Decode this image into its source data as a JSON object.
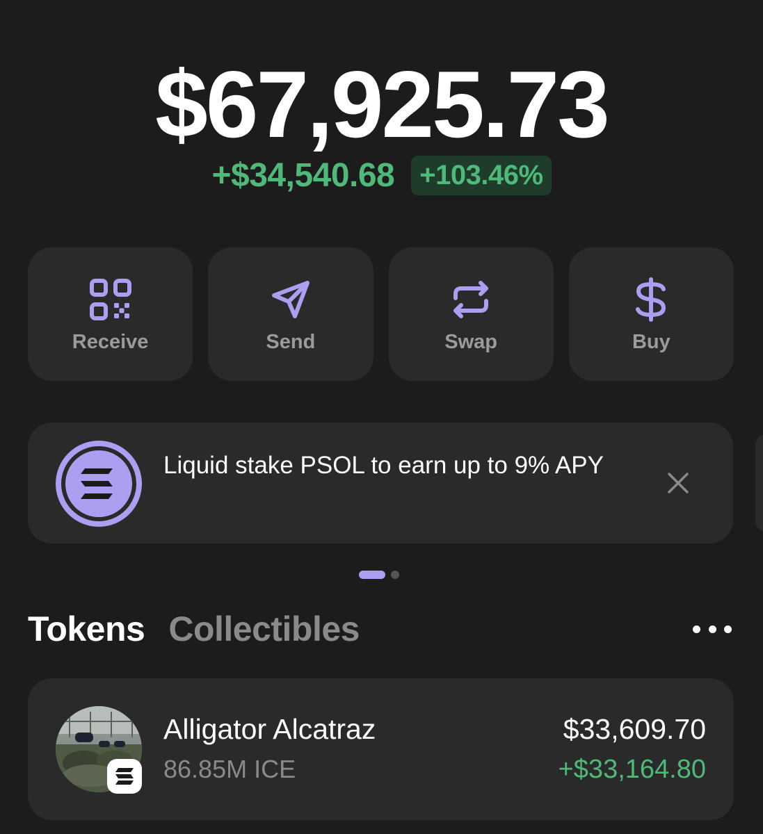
{
  "portfolio": {
    "balance": "$67,925.73",
    "change_amount": "+$34,540.68",
    "change_percent": "+103.46%"
  },
  "actions": [
    {
      "label": "Receive",
      "icon": "qr-code-icon"
    },
    {
      "label": "Send",
      "icon": "send-icon"
    },
    {
      "label": "Swap",
      "icon": "swap-icon"
    },
    {
      "label": "Buy",
      "icon": "dollar-icon"
    }
  ],
  "promo": {
    "text": "Liquid stake PSOL to earn up to 9% APY",
    "logo": "solana-logo-icon",
    "close_icon": "close-icon",
    "page_index": 1,
    "page_count": 2
  },
  "tabs": {
    "active": "Tokens",
    "items": [
      "Tokens",
      "Collectibles"
    ],
    "more_icon": "more-horizontal-icon"
  },
  "tokens": [
    {
      "name": "Alligator Alcatraz",
      "amount": "86.85M ICE",
      "value": "$33,609.70",
      "change": "+$33,164.80",
      "chain": "solana"
    }
  ],
  "colors": {
    "background": "#1c1c1c",
    "card": "#2a2a2a",
    "accent": "#ab9ff2",
    "positive": "#4fb97a",
    "positive_bg": "#1f3b2a",
    "muted_text": "#8a8a8a"
  }
}
